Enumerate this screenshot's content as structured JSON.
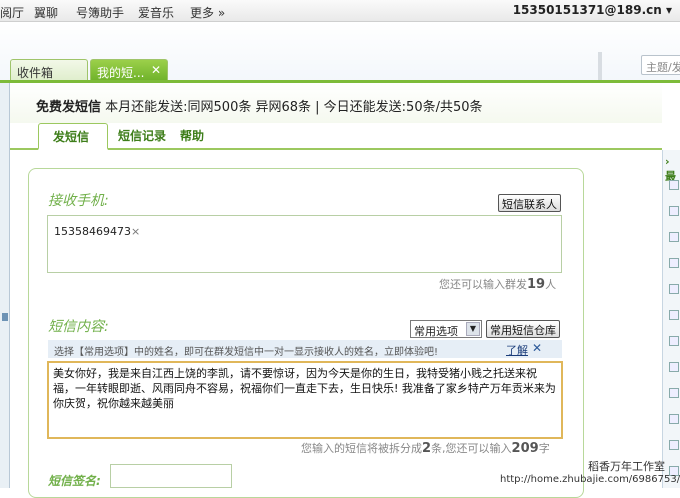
{
  "topbar": {
    "nav": [
      "阅厅",
      "翼聊",
      "号簿助手",
      "爱音乐",
      "更多 »"
    ],
    "account": "15350151371@189.cn ▾"
  },
  "search": {
    "placeholder": "主题/发"
  },
  "tabs": [
    {
      "label": "收件箱"
    },
    {
      "label": "我的短...",
      "close": "✕"
    }
  ],
  "header": {
    "title": "免费发短信",
    "quota": "本月还能发送:同网500条 异网68条 | 今日还能发送:50条/共50条"
  },
  "subnav": [
    "发短信",
    "短信记录",
    "帮助"
  ],
  "recipients": {
    "label": "接收手机:",
    "contacts_button": "短信联系人",
    "chips": [
      {
        "number": "15358469473",
        "remove": "×"
      }
    ],
    "remaining_prefix": "您还可以输入群发",
    "remaining_count": "19",
    "remaining_suffix": "人"
  },
  "message": {
    "label": "短信内容:",
    "phrases_select": "常用选项",
    "warehouse_button": "常用短信仓库",
    "tip": "选择【常用选项】中的姓名，即可在群发短信中一对一显示接收人的姓名，立即体验吧!",
    "tip_link": "了解",
    "tip_close": "✕",
    "body": "美女你好，我是来自江西上饶的李凯，请不要惊讶，因为今天是你的生日，我特受猪小贱之托送来祝福，一年转眼即逝、风雨同舟不容易，祝福你们一直走下去，生日快乐! 我准备了家乡特产万年贡米来为你庆贺，祝你越来越美丽",
    "split_prefix": "您输入的短信将被拆分成",
    "split_count": "2",
    "split_middle": "条,您还可以输入",
    "chars_left": "209",
    "split_suffix": "字"
  },
  "signature": {
    "label": "短信签名:"
  },
  "right_panel": {
    "header": "› 最"
  },
  "watermark": {
    "line1": "稻香万年工作室",
    "line2": "http://home.zhubajie.com/6986753/"
  }
}
